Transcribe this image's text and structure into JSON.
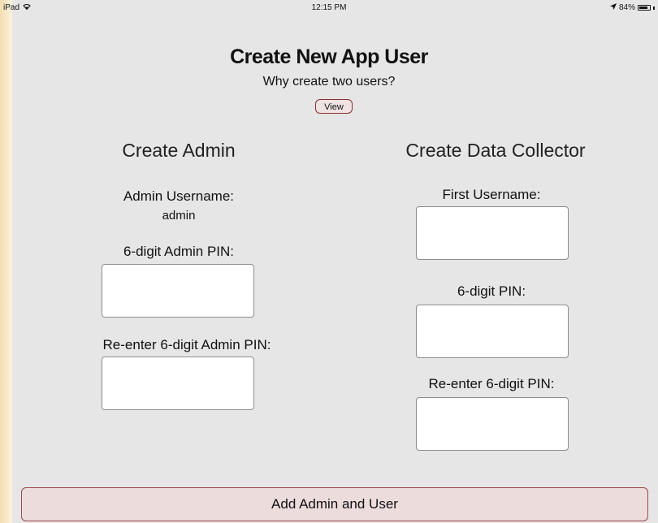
{
  "status_bar": {
    "device": "iPad",
    "time": "12:15 PM",
    "battery_text": "84%",
    "battery_level": 0.84
  },
  "header": {
    "title": "Create New App User",
    "subtitle": "Why create two users?",
    "view_label": "View"
  },
  "admin": {
    "heading": "Create Admin",
    "username_label": "Admin Username:",
    "username_value": "admin",
    "pin_label": "6-digit Admin PIN:",
    "pin_value": "",
    "reenter_label": "Re-enter 6-digit Admin PIN:",
    "reenter_value": ""
  },
  "collector": {
    "heading": "Create Data Collector",
    "username_label": "First Username:",
    "username_value": "",
    "pin_label": "6-digit PIN:",
    "pin_value": "",
    "reenter_label": "Re-enter 6-digit PIN:",
    "reenter_value": ""
  },
  "submit_label": "Add Admin and User"
}
